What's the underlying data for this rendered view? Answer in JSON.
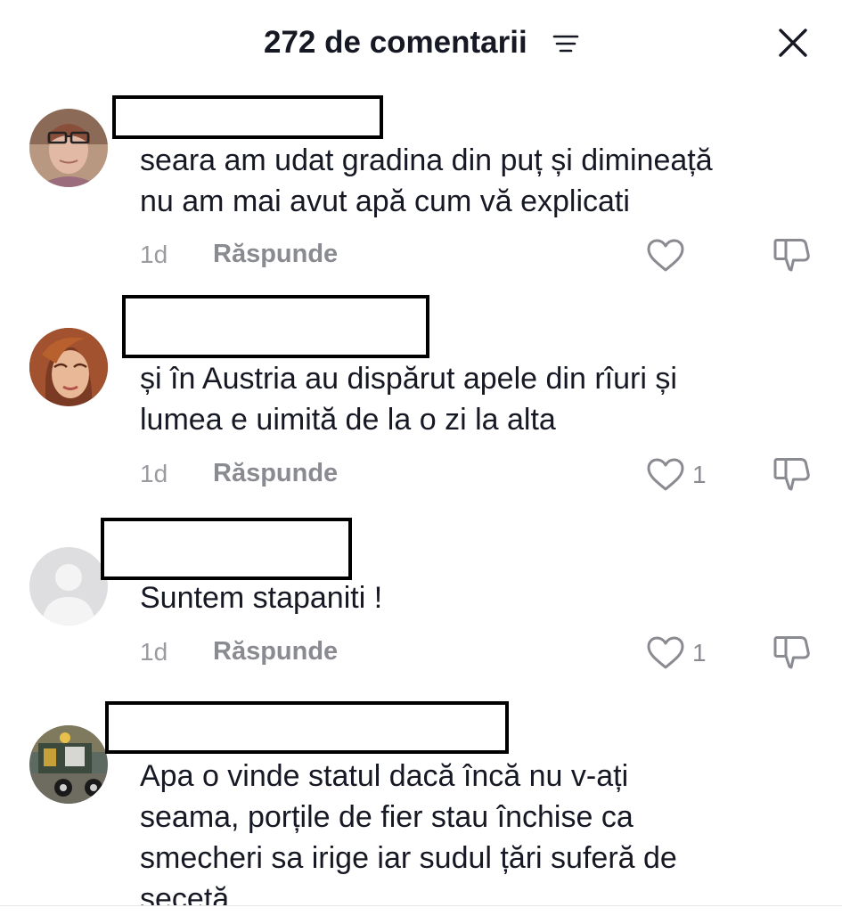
{
  "header": {
    "title": "272 de comentarii",
    "sort_icon": "sort-lines-icon",
    "close_icon": "close-x-icon"
  },
  "icons": {
    "like": "heart-outline-icon",
    "dislike": "thumbs-down-outline-icon"
  },
  "colors": {
    "text_primary": "#161823",
    "text_secondary": "#8a8b91",
    "redaction_border": "#000000"
  },
  "comments": [
    {
      "avatar": "avatar-woman-glasses",
      "text": "seara am udat gradina din puț și dimineață\nnu am mai avut apă cum vă explicati",
      "time": "1d",
      "reply_label": "Răspunde",
      "likes": ""
    },
    {
      "avatar": "avatar-woman-red-hair",
      "text": "și în Austria au dispărut apele din rîuri și\nlumea e uimită de la o zi la alta",
      "time": "1d",
      "reply_label": "Răspunde",
      "likes": "1"
    },
    {
      "avatar": "avatar-default-grey",
      "text": "Suntem stapaniti !",
      "time": "1d",
      "reply_label": "Răspunde",
      "likes": "1"
    },
    {
      "avatar": "avatar-machinery",
      "text": "Apa o vinde statul dacă încă nu v-ați\nseama, porțile de fier stau închise ca\nsmecheri sa irige iar sudul țări suferă de\nsecetă",
      "time": "",
      "reply_label": "",
      "likes": ""
    }
  ]
}
